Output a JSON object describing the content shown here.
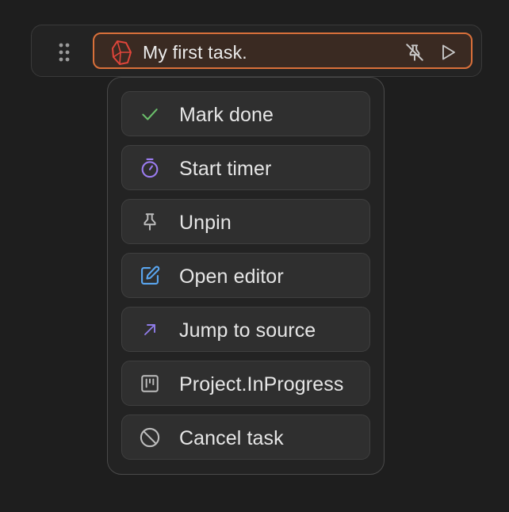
{
  "task": {
    "title": "My first task.",
    "accent_color": "#d9703a",
    "icons": {
      "drag": "drag-handle-icon",
      "logo": "obsidian-logo-icon",
      "unpin": "pin-off-icon",
      "play": "play-icon"
    }
  },
  "menu": {
    "items": [
      {
        "label": "Mark done",
        "icon": "check-icon",
        "icon_color": "#6bbf6b"
      },
      {
        "label": "Start timer",
        "icon": "timer-icon",
        "icon_color": "#9b7cf0"
      },
      {
        "label": "Unpin",
        "icon": "pin-icon",
        "icon_color": "#bdbdbd"
      },
      {
        "label": "Open editor",
        "icon": "edit-icon",
        "icon_color": "#5aa6f0"
      },
      {
        "label": "Jump to source",
        "icon": "arrow-up-right-icon",
        "icon_color": "#8f7ce8"
      },
      {
        "label": "Project.InProgress",
        "icon": "kanban-icon",
        "icon_color": "#bdbdbd"
      },
      {
        "label": "Cancel task",
        "icon": "cancel-icon",
        "icon_color": "#bdbdbd"
      }
    ]
  }
}
